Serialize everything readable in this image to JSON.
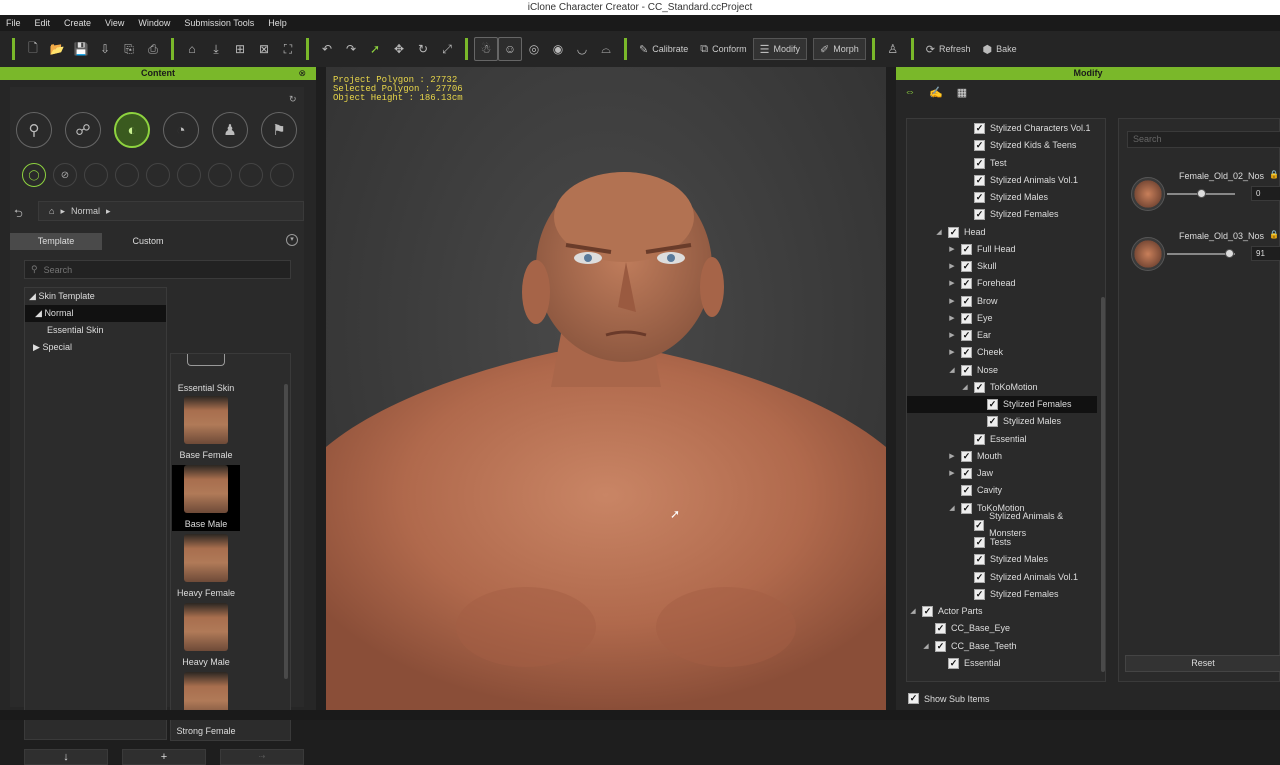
{
  "window": {
    "title": "iClone Character Creator - CC_Standard.ccProject"
  },
  "menu": [
    "File",
    "Edit",
    "Create",
    "View",
    "Window",
    "Submission Tools",
    "Help"
  ],
  "toolbar": {
    "calibrate": "Calibrate",
    "conform": "Conform",
    "modify": "Modify",
    "morph": "Morph",
    "refresh": "Refresh",
    "bake": "Bake"
  },
  "content_panel": {
    "title": "Content",
    "breadcrumb": "Normal",
    "tabs": [
      "Template",
      "Custom"
    ],
    "search_placeholder": "Search",
    "tree": [
      {
        "label": "Skin Template",
        "prefix": "◢"
      },
      {
        "label": "Normal",
        "prefix": "◢"
      },
      {
        "label": "Essential Skin",
        "prefix": ""
      },
      {
        "label": "Special",
        "prefix": "▶"
      }
    ],
    "thumbnails": [
      "Essential Skin",
      "Base Female",
      "Base Male",
      "Heavy Female",
      "Heavy Male",
      "Strong Female"
    ]
  },
  "viewport": {
    "project_polygon": "Project Polygon : 27732",
    "selected_polygon": "Selected Polygon : 27706",
    "object_height": "Object Height : 186.13cm"
  },
  "modify_panel": {
    "title": "Modify",
    "tree": [
      {
        "label": "Stylized Characters Vol.1",
        "indent": 4,
        "exp": ""
      },
      {
        "label": "Stylized Kids & Teens",
        "indent": 4,
        "exp": ""
      },
      {
        "label": "Test",
        "indent": 4,
        "exp": ""
      },
      {
        "label": "Stylized Animals Vol.1",
        "indent": 4,
        "exp": ""
      },
      {
        "label": "Stylized Males",
        "indent": 4,
        "exp": ""
      },
      {
        "label": "Stylized Females",
        "indent": 4,
        "exp": ""
      },
      {
        "label": "Head",
        "indent": 2,
        "exp": "◢"
      },
      {
        "label": "Full Head",
        "indent": 3,
        "exp": "▶"
      },
      {
        "label": "Skull",
        "indent": 3,
        "exp": "▶"
      },
      {
        "label": "Forehead",
        "indent": 3,
        "exp": "▶"
      },
      {
        "label": "Brow",
        "indent": 3,
        "exp": "▶"
      },
      {
        "label": "Eye",
        "indent": 3,
        "exp": "▶"
      },
      {
        "label": "Ear",
        "indent": 3,
        "exp": "▶"
      },
      {
        "label": "Cheek",
        "indent": 3,
        "exp": "▶"
      },
      {
        "label": "Nose",
        "indent": 3,
        "exp": "◢"
      },
      {
        "label": "ToKoMotion",
        "indent": 4,
        "exp": "◢"
      },
      {
        "label": "Stylized Females",
        "indent": 5,
        "exp": "",
        "selected": true
      },
      {
        "label": "Stylized Males",
        "indent": 5,
        "exp": ""
      },
      {
        "label": "Essential",
        "indent": 4,
        "exp": ""
      },
      {
        "label": "Mouth",
        "indent": 3,
        "exp": "▶"
      },
      {
        "label": "Jaw",
        "indent": 3,
        "exp": "▶"
      },
      {
        "label": "Cavity",
        "indent": 3,
        "exp": ""
      },
      {
        "label": "ToKoMotion",
        "indent": 3,
        "exp": "◢"
      },
      {
        "label": "Stylized Animals & Monsters",
        "indent": 4,
        "exp": ""
      },
      {
        "label": "Tests",
        "indent": 4,
        "exp": ""
      },
      {
        "label": "Stylized Males",
        "indent": 4,
        "exp": ""
      },
      {
        "label": "Stylized Animals Vol.1",
        "indent": 4,
        "exp": ""
      },
      {
        "label": "Stylized Females",
        "indent": 4,
        "exp": ""
      },
      {
        "label": "Actor Parts",
        "indent": 0,
        "exp": "◢"
      },
      {
        "label": "CC_Base_Eye",
        "indent": 1,
        "exp": ""
      },
      {
        "label": "CC_Base_Teeth",
        "indent": 1,
        "exp": "◢"
      },
      {
        "label": "Essential",
        "indent": 2,
        "exp": ""
      }
    ],
    "show_sub_items": "Show Sub Items",
    "search_placeholder": "Search",
    "sliders": [
      {
        "label": "Female_Old_02_Nos",
        "value": "0",
        "level": 0.5
      },
      {
        "label": "Female_Old_03_Nos",
        "value": "91",
        "level": 0.91
      }
    ],
    "reset": "Reset"
  }
}
